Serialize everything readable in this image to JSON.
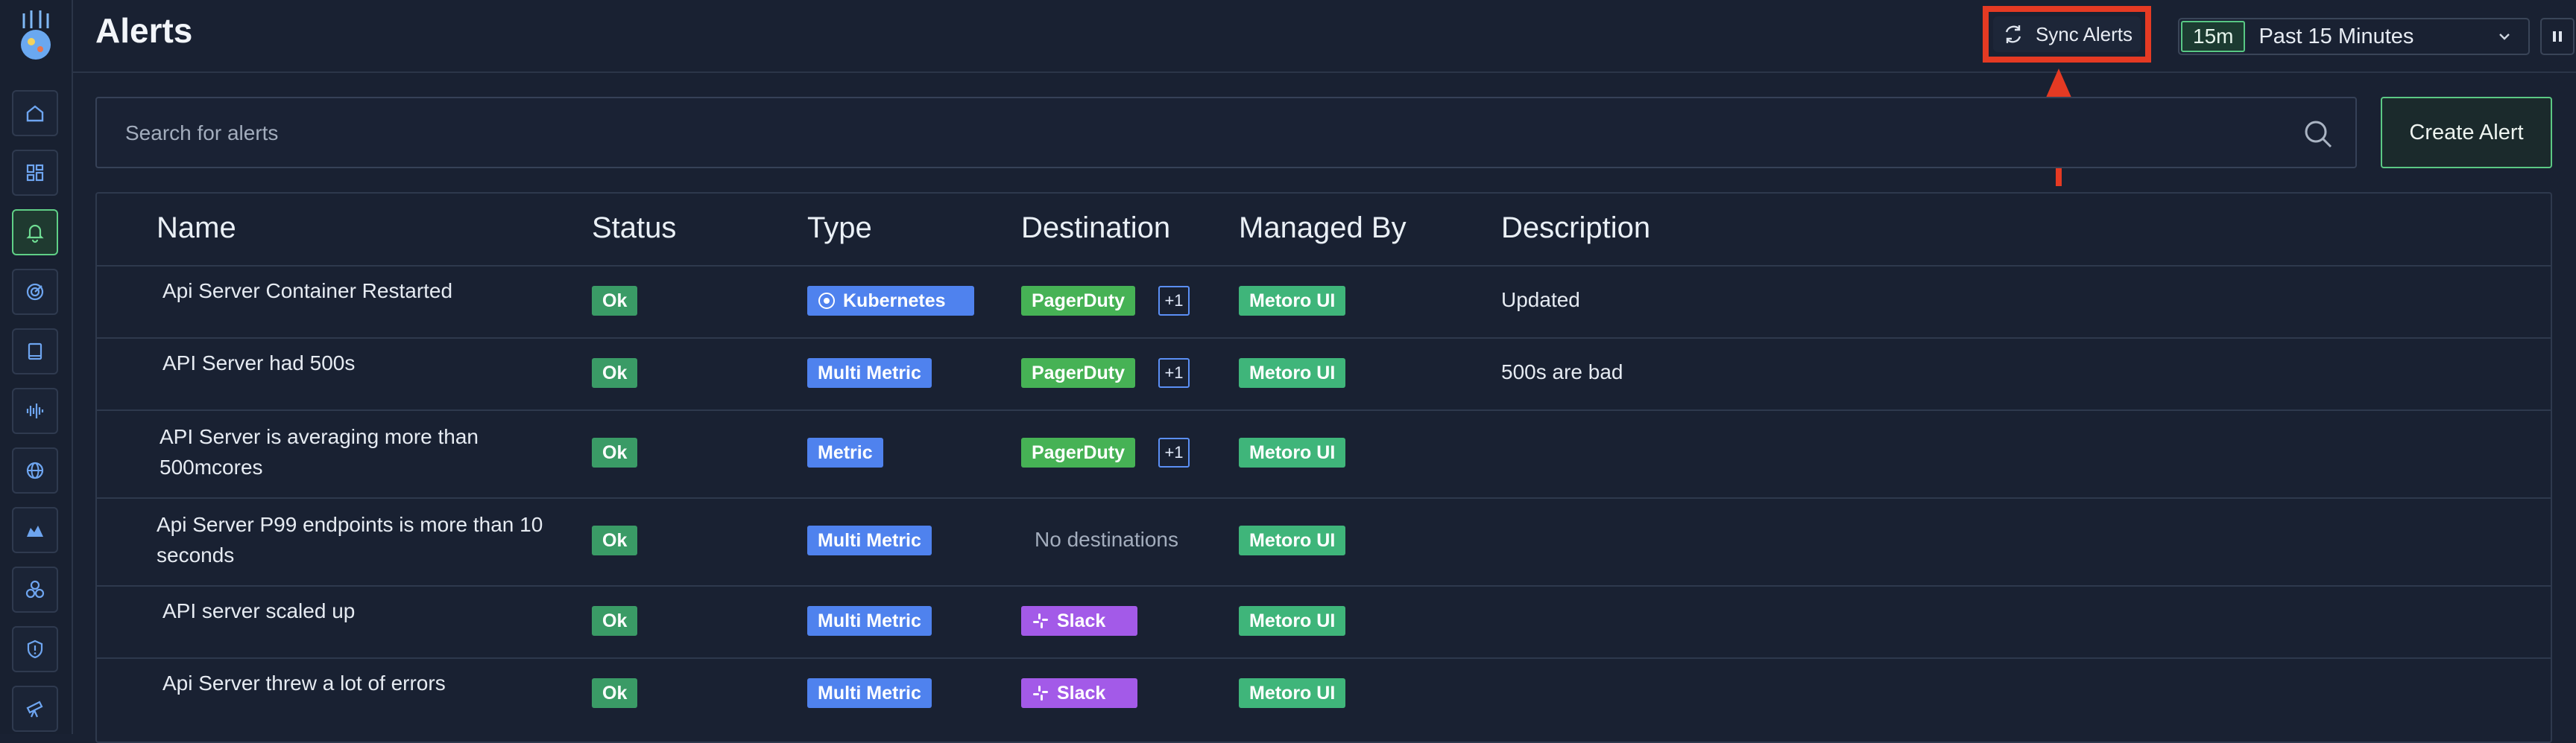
{
  "page": {
    "title": "Alerts"
  },
  "header": {
    "sync_label": "Sync Alerts",
    "range_chip": "15m",
    "range_label": "Past 15 Minutes"
  },
  "search": {
    "placeholder": "Search for alerts"
  },
  "actions": {
    "create_label": "Create Alert"
  },
  "table": {
    "columns": [
      "Name",
      "Status",
      "Type",
      "Destination",
      "Managed By",
      "Description"
    ],
    "rows": [
      {
        "name_lines": [
          "Api Server Container Restarted"
        ],
        "status": "Ok",
        "type": "Kubernetes",
        "type_icon": "kubernetes-icon",
        "destination": "PagerDuty",
        "dest_more": "+1",
        "managed_by": "Metoro UI",
        "description": "Updated"
      },
      {
        "name_lines": [
          "API Server had 500s"
        ],
        "status": "Ok",
        "type": "Multi Metric",
        "destination": "PagerDuty",
        "dest_more": "+1",
        "managed_by": "Metoro UI",
        "description": "500s are bad"
      },
      {
        "name_lines": [
          "API Server is averaging more than",
          "500mcores"
        ],
        "status": "Ok",
        "type": "Metric",
        "destination": "PagerDuty",
        "dest_more": "+1",
        "managed_by": "Metoro UI",
        "description": ""
      },
      {
        "name_lines": [
          "Api Server P99 endpoints is more than 10",
          "seconds"
        ],
        "status": "Ok",
        "type": "Multi Metric",
        "destination_text": "No destinations",
        "managed_by": "Metoro UI",
        "description": ""
      },
      {
        "name_lines": [
          "API server scaled up"
        ],
        "status": "Ok",
        "type": "Multi Metric",
        "destination": "Slack",
        "dest_icon": "slack-icon",
        "managed_by": "Metoro UI",
        "description": ""
      },
      {
        "name_lines": [
          "Api Server threw a lot of errors"
        ],
        "status": "Ok",
        "type": "Multi Metric",
        "destination": "Slack",
        "dest_icon": "slack-icon",
        "managed_by": "Metoro UI",
        "description": ""
      }
    ]
  },
  "sidebar": {
    "items": [
      "home-icon",
      "dashboards-icon",
      "bell-icon",
      "radar-icon",
      "book-icon",
      "waveform-icon",
      "globe-icon",
      "map-icon",
      "nodes-icon",
      "shield-icon",
      "telescope-icon"
    ],
    "active_item": "bell-icon"
  },
  "colors": {
    "background": "#192132",
    "accent": "#5fcf86",
    "highlight_annotation": "#e53a23",
    "type_badge": "#4f82ee",
    "pagerduty_badge": "#46b255",
    "slack_badge": "#a35ae8",
    "managed_badge": "#3fb57a",
    "ok_badge": "#3a9b66"
  }
}
